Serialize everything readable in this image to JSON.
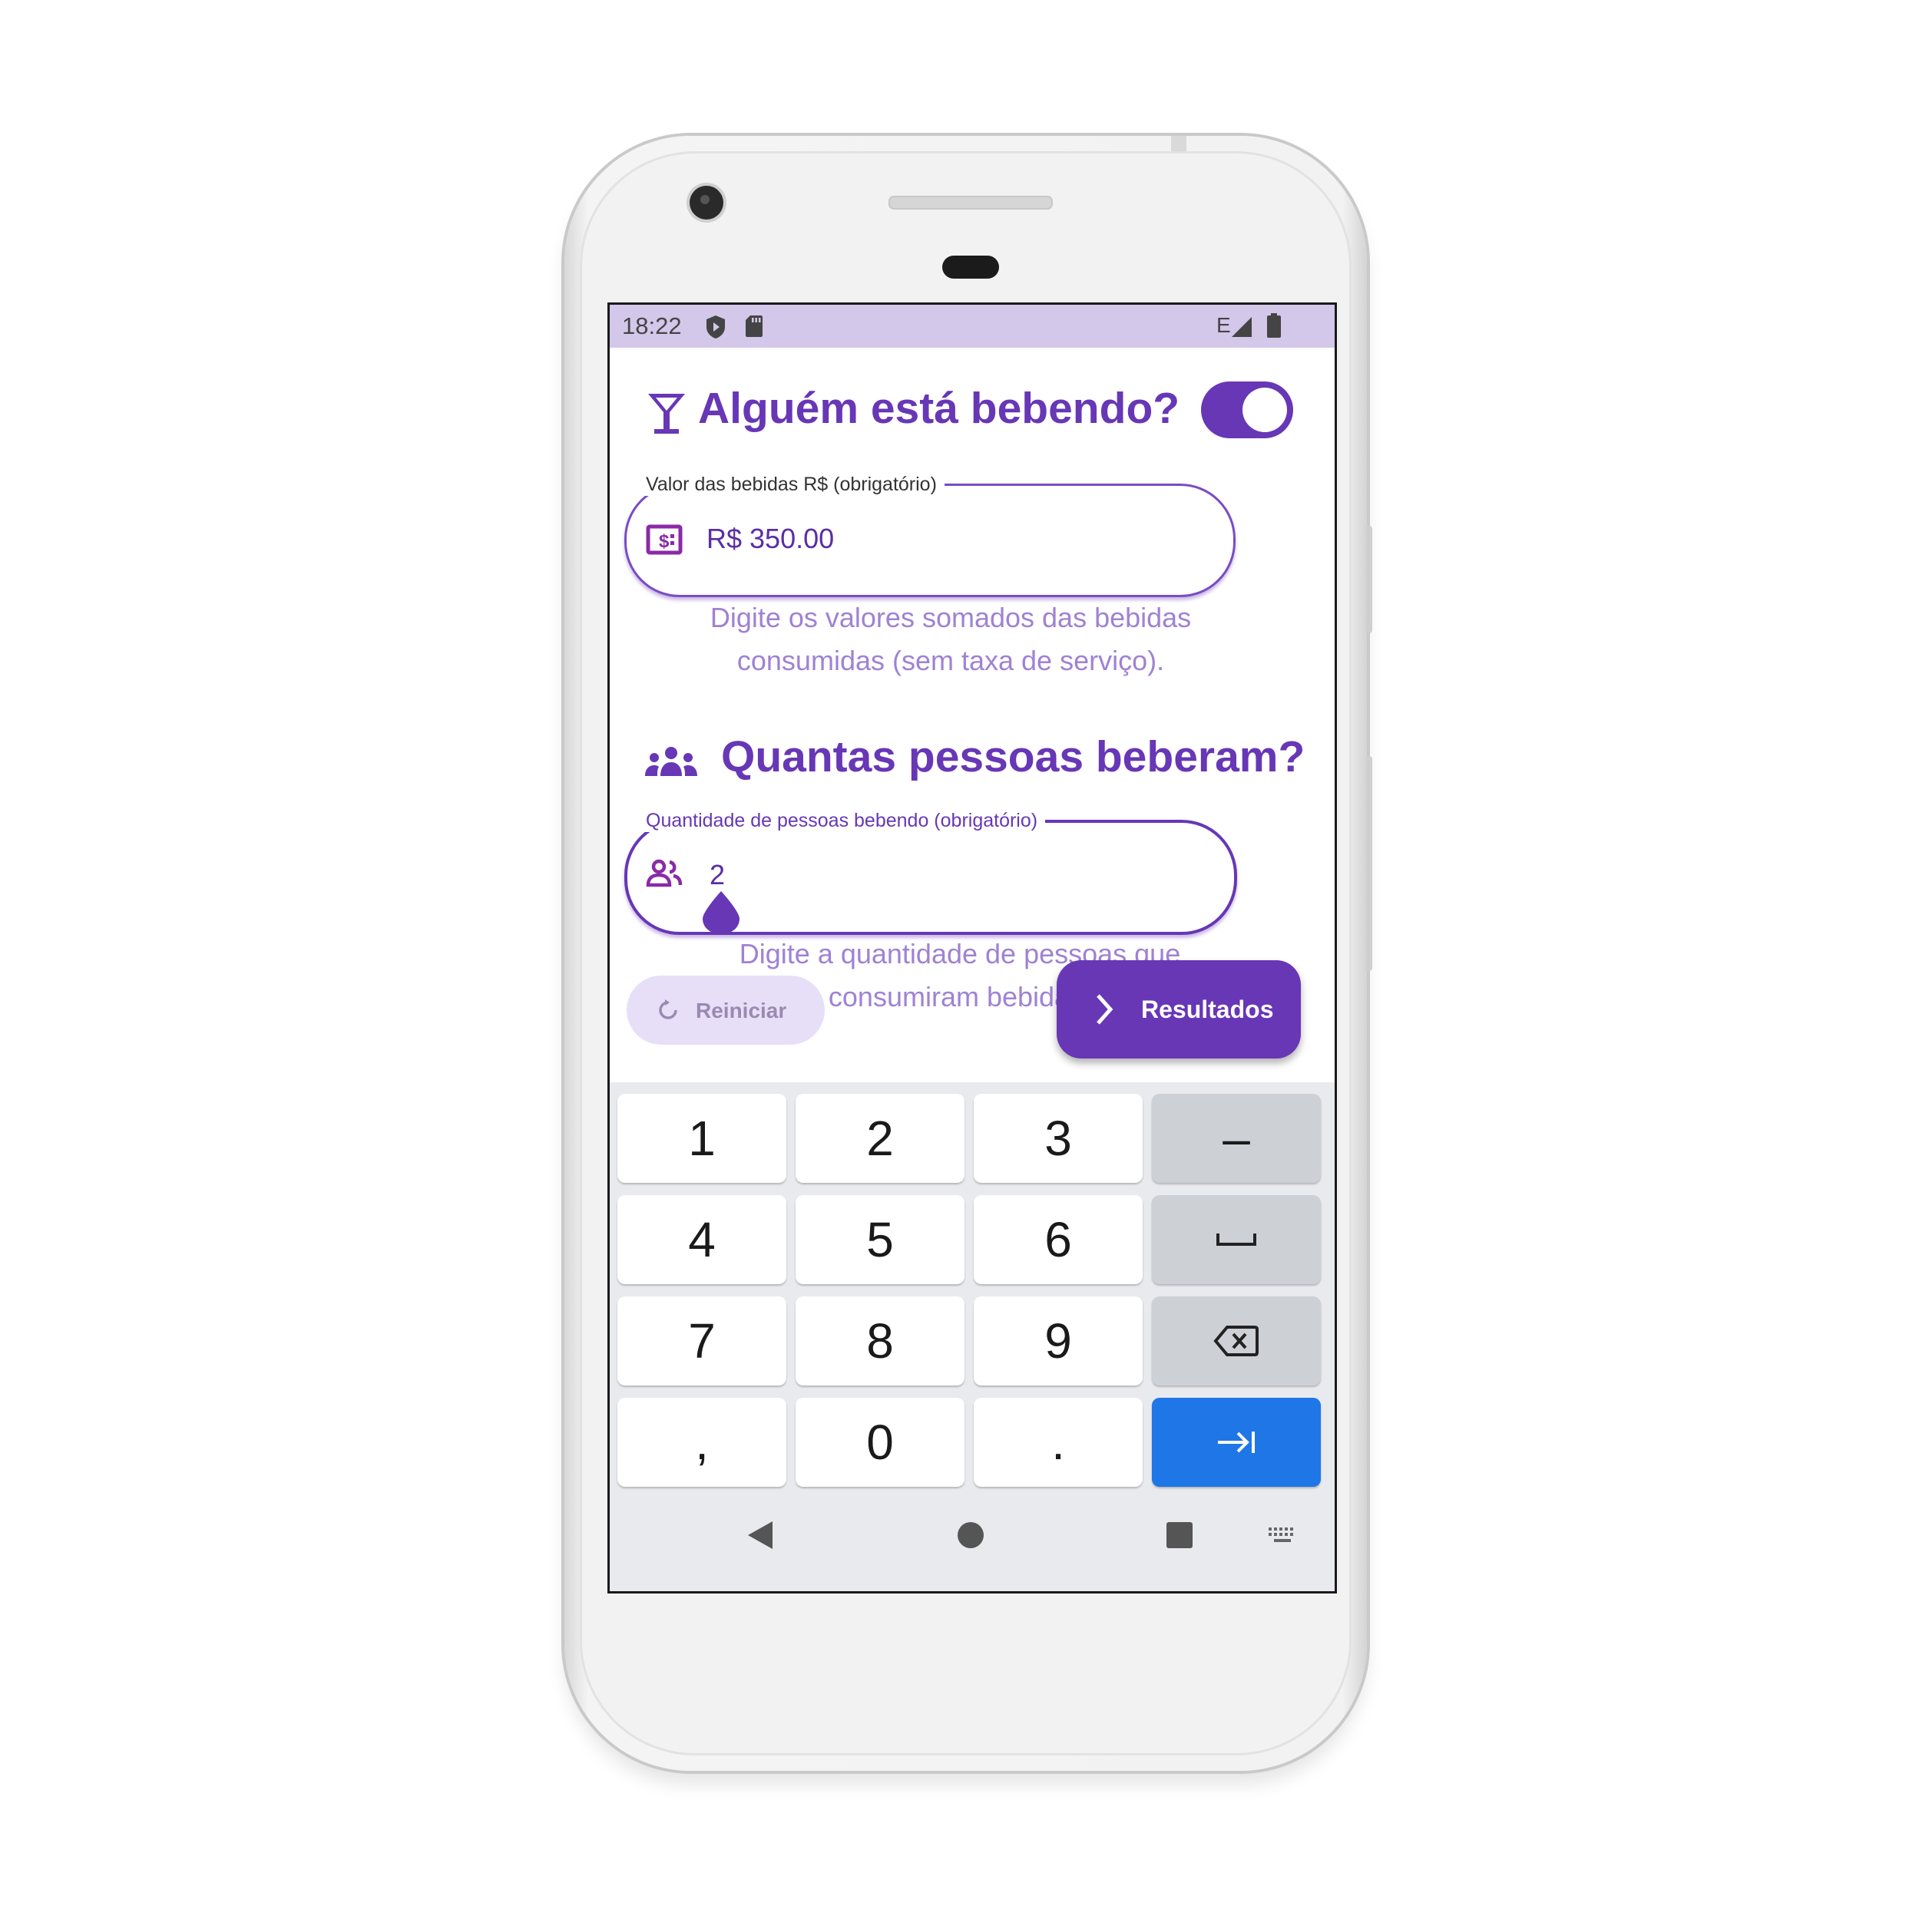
{
  "status_bar": {
    "time": "18:22",
    "network": "E"
  },
  "drinking_section": {
    "title": "Alguém está bebendo?",
    "toggle_on": true
  },
  "drinks_field": {
    "label": "Valor das bebidas R$ (obrigatório)",
    "value": "R$ 350.00",
    "helper_line1": "Digite os valores somados das bebidas",
    "helper_line2": "consumidas (sem taxa de serviço)."
  },
  "people_section": {
    "title": "Quantas pessoas beberam?"
  },
  "people_field": {
    "label": "Quantidade de pessoas bebendo (obrigatório)",
    "value": "2",
    "helper_line1": "Digite a quantidade de pessoas que",
    "helper_line2": "consumiram bebidas."
  },
  "actions": {
    "reset_label": "Reiniciar",
    "results_label": "Resultados"
  },
  "keyboard": {
    "rows": [
      [
        "1",
        "2",
        "3",
        "–"
      ],
      [
        "4",
        "5",
        "6",
        "␣"
      ],
      [
        "7",
        "8",
        "9",
        "⌫"
      ],
      [
        ",",
        "0",
        ".",
        "→|"
      ]
    ]
  },
  "colors": {
    "primary": "#6737b6",
    "status_bar": "#d3c7ea",
    "helper_text": "#9f82d3",
    "keyboard_action": "#1f76e6"
  }
}
